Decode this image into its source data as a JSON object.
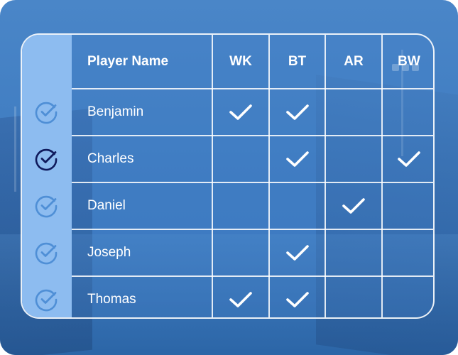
{
  "table": {
    "columns": [
      "Player Name",
      "WK",
      "BT",
      "AR",
      "BW"
    ],
    "rows": [
      {
        "name": "Benjamin",
        "selected": false,
        "marks": [
          true,
          true,
          false,
          false
        ]
      },
      {
        "name": "Charles",
        "selected": true,
        "marks": [
          false,
          true,
          false,
          true
        ]
      },
      {
        "name": "Daniel",
        "selected": false,
        "marks": [
          false,
          false,
          true,
          false
        ]
      },
      {
        "name": "Joseph",
        "selected": false,
        "marks": [
          false,
          true,
          false,
          false
        ]
      },
      {
        "name": "Thomas",
        "selected": false,
        "marks": [
          true,
          true,
          false,
          false
        ]
      }
    ]
  },
  "icons": {
    "row_check": "circle-check-icon",
    "cell_check": "checkmark-icon"
  },
  "colors": {
    "background": "#3f7cc1",
    "left_column": "#8dbcf0",
    "selected_circle": "#0f1a5c",
    "unselected_circle": "#4f8fd6",
    "text": "#ffffff"
  }
}
